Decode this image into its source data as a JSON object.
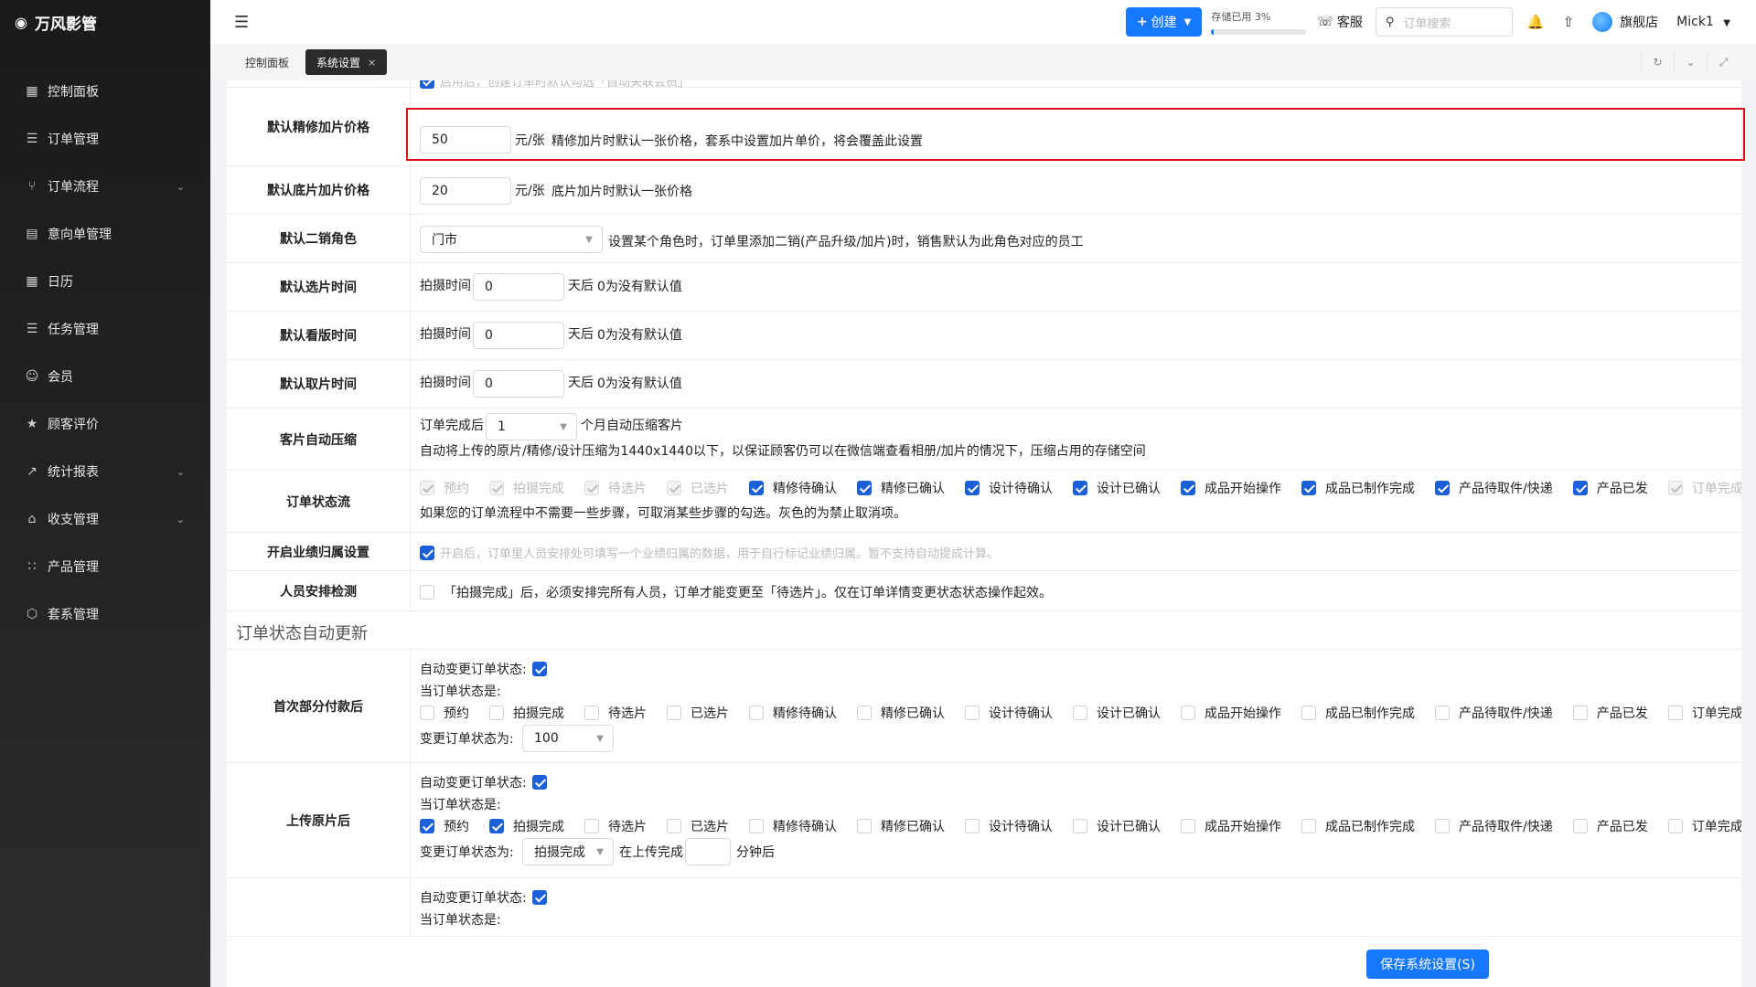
{
  "brand": {
    "name": "万风影管",
    "icon": "camera-icon"
  },
  "sidebar": {
    "items": [
      {
        "label": "控制面板",
        "icon": "grid-icon",
        "has_children": false
      },
      {
        "label": "订单管理",
        "icon": "list-icon",
        "has_children": false
      },
      {
        "label": "订单流程",
        "icon": "flow-icon",
        "has_children": true
      },
      {
        "label": "意向单管理",
        "icon": "document-icon",
        "has_children": false
      },
      {
        "label": "日历",
        "icon": "calendar-icon",
        "has_children": false
      },
      {
        "label": "任务管理",
        "icon": "tasks-icon",
        "has_children": false
      },
      {
        "label": "会员",
        "icon": "user-icon",
        "has_children": false
      },
      {
        "label": "顾客评价",
        "icon": "star-icon",
        "has_children": false
      },
      {
        "label": "统计报表",
        "icon": "chart-icon",
        "has_children": true
      },
      {
        "label": "收支管理",
        "icon": "bank-icon",
        "has_children": true
      },
      {
        "label": "产品管理",
        "icon": "apps-icon",
        "has_children": false
      },
      {
        "label": "套系管理",
        "icon": "package-icon",
        "has_children": false
      }
    ]
  },
  "header": {
    "create_label": "创建",
    "storage_label": "存储已用 3%",
    "storage_used": 0.03,
    "support_label": "客服",
    "search_placeholder": "订单搜索",
    "store_name": "旗舰店",
    "user_name": "Mick1"
  },
  "tabs": [
    {
      "label": "控制面板",
      "active": false
    },
    {
      "label": "系统设置",
      "active": true
    }
  ],
  "tab_close": "×",
  "settings": {
    "partial_top": {
      "hint": "启用后，创建订单时默认勾选「自动关联会员」"
    },
    "retouch_price": {
      "label": "默认精修加片价格",
      "value": "50",
      "unit": "元/张",
      "hint": "精修加片时默认一张价格，套系中设置加片单价，将会覆盖此设置"
    },
    "raw_price": {
      "label": "默认底片加片价格",
      "value": "20",
      "unit": "元/张",
      "hint": "底片加片时默认一张价格"
    },
    "second_role": {
      "label": "默认二销角色",
      "value": "门市",
      "hint": "设置某个角色时，订单里添加二销(产品升级/加片)时，销售默认为此角色对应的员工"
    },
    "select_time": {
      "label": "默认选片时间",
      "prefix": "拍摄时间",
      "value": "0",
      "suffix": "天后",
      "hint": "0为没有默认值"
    },
    "proof_time": {
      "label": "默认看版时间",
      "prefix": "拍摄时间",
      "value": "0",
      "suffix": "天后",
      "hint": "0为没有默认值"
    },
    "pickup_time": {
      "label": "默认取片时间",
      "prefix": "拍摄时间",
      "value": "0",
      "suffix": "天后",
      "hint": "0为没有默认值"
    },
    "compress": {
      "label": "客片自动压缩",
      "prefix": "订单完成后",
      "value": "1",
      "suffix": "个月自动压缩客片",
      "hint": "自动将上传的原片/精修/设计压缩为1440x1440以下，以保证顾客仍可以在微信端查看相册/加片的情况下，压缩占用的存储空间"
    },
    "status_flow": {
      "label": "订单状态流",
      "items": [
        {
          "label": "预约",
          "state": "disabled"
        },
        {
          "label": "拍摄完成",
          "state": "disabled"
        },
        {
          "label": "待选片",
          "state": "disabled"
        },
        {
          "label": "已选片",
          "state": "disabled"
        },
        {
          "label": "精修待确认",
          "state": "on"
        },
        {
          "label": "精修已确认",
          "state": "on"
        },
        {
          "label": "设计待确认",
          "state": "on"
        },
        {
          "label": "设计已确认",
          "state": "on"
        },
        {
          "label": "成品开始操作",
          "state": "on"
        },
        {
          "label": "成品已制作完成",
          "state": "on"
        },
        {
          "label": "产品待取件/快递",
          "state": "on"
        },
        {
          "label": "产品已发",
          "state": "on"
        },
        {
          "label": "订单完成",
          "state": "disabled"
        }
      ],
      "hint": "如果您的订单流程中不需要一些步骤，可取消某些步骤的勾选。灰色的为禁止取消项。"
    },
    "performance": {
      "label": "开启业绩归属设置",
      "checked": true,
      "hint": "开启后，订单里人员安排处可填写一个业绩归属的数据，用于自行标记业绩归属。暂不支持自动提成计算。"
    },
    "staff_check": {
      "label": "人员安排检测",
      "checked": false,
      "text": "「拍摄完成」后，必须安排完所有人员，订单才能变更至「待选片」。仅在订单详情变更状态状态操作起效。"
    }
  },
  "auto_update": {
    "section_title": "订单状态自动更新",
    "auto_change_label": "自动变更订单状态:",
    "current_status_label": "当订单状态是:",
    "change_to_label": "变更订单状态为:",
    "status_names": [
      "预约",
      "拍摄完成",
      "待选片",
      "已选片",
      "精修待确认",
      "精修已确认",
      "设计待确认",
      "设计已确认",
      "成品开始操作",
      "成品已制作完成",
      "产品待取件/快递",
      "产品已发",
      "订单完成"
    ],
    "first_payment": {
      "label": "首次部分付款后",
      "auto": true,
      "checked": [
        false,
        false,
        false,
        false,
        false,
        false,
        false,
        false,
        false,
        false,
        false,
        false,
        false
      ],
      "change_to": "100"
    },
    "upload_raw": {
      "label": "上传原片后",
      "auto": true,
      "checked": [
        true,
        true,
        false,
        false,
        false,
        false,
        false,
        false,
        false,
        false,
        false,
        false,
        false
      ],
      "change_to": "拍摄完成",
      "after_prefix": "在上传完成",
      "after_value": "",
      "after_suffix": "分钟后"
    },
    "third": {
      "auto": true
    }
  },
  "footer": {
    "save_label": "保存系统设置(S)"
  }
}
